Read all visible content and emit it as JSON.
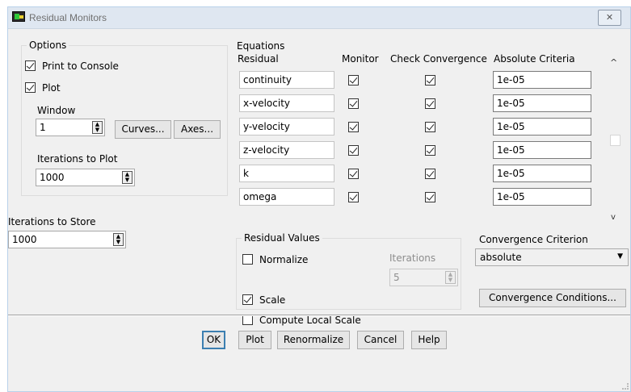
{
  "window": {
    "title": "Residual Monitors",
    "close_glyph": "✕"
  },
  "options": {
    "legend": "Options",
    "print_to_console": {
      "label": "Print to Console",
      "checked": true
    },
    "plot": {
      "label": "Plot",
      "checked": true
    },
    "window_label": "Window",
    "window_value": "1",
    "curves_button": "Curves...",
    "axes_button": "Axes...",
    "iterations_to_plot_label": "Iterations to Plot",
    "iterations_to_plot_value": "1000"
  },
  "iterations_to_store": {
    "label": "Iterations to Store",
    "value": "1000"
  },
  "equations": {
    "title": "Equations",
    "headers": {
      "residual": "Residual",
      "monitor": "Monitor",
      "check_convergence": "Check Convergence",
      "absolute_criteria": "Absolute Criteria"
    },
    "rows": [
      {
        "residual": "continuity",
        "monitor": true,
        "check": true,
        "criteria": "1e-05"
      },
      {
        "residual": "x-velocity",
        "monitor": true,
        "check": true,
        "criteria": "1e-05"
      },
      {
        "residual": "y-velocity",
        "monitor": true,
        "check": true,
        "criteria": "1e-05"
      },
      {
        "residual": "z-velocity",
        "monitor": true,
        "check": true,
        "criteria": "1e-05"
      },
      {
        "residual": "k",
        "monitor": true,
        "check": true,
        "criteria": "1e-05"
      },
      {
        "residual": "omega",
        "monitor": true,
        "check": true,
        "criteria": "1e-05"
      }
    ]
  },
  "residual_values": {
    "legend": "Residual Values",
    "normalize": {
      "label": "Normalize",
      "checked": false
    },
    "iterations_label": "Iterations",
    "iterations_value": "5",
    "scale": {
      "label": "Scale",
      "checked": true
    },
    "compute_local_scale": {
      "label": "Compute Local Scale",
      "checked": false
    }
  },
  "convergence": {
    "criterion_label": "Convergence Criterion",
    "criterion_value": "absolute",
    "conditions_button": "Convergence Conditions..."
  },
  "footer": {
    "ok": "OK",
    "plot": "Plot",
    "renormalize": "Renormalize",
    "cancel": "Cancel",
    "help": "Help"
  },
  "icons": {
    "dropdown": "chevron-down-icon",
    "scroll_up": "chevron-up-icon",
    "scroll_down": "chevron-down-icon",
    "close": "close-icon"
  },
  "colors": {
    "default_button_border": "#3c7fb1",
    "titlebar": "#dfe7f1",
    "dialog_bg": "#f0f0f0"
  }
}
